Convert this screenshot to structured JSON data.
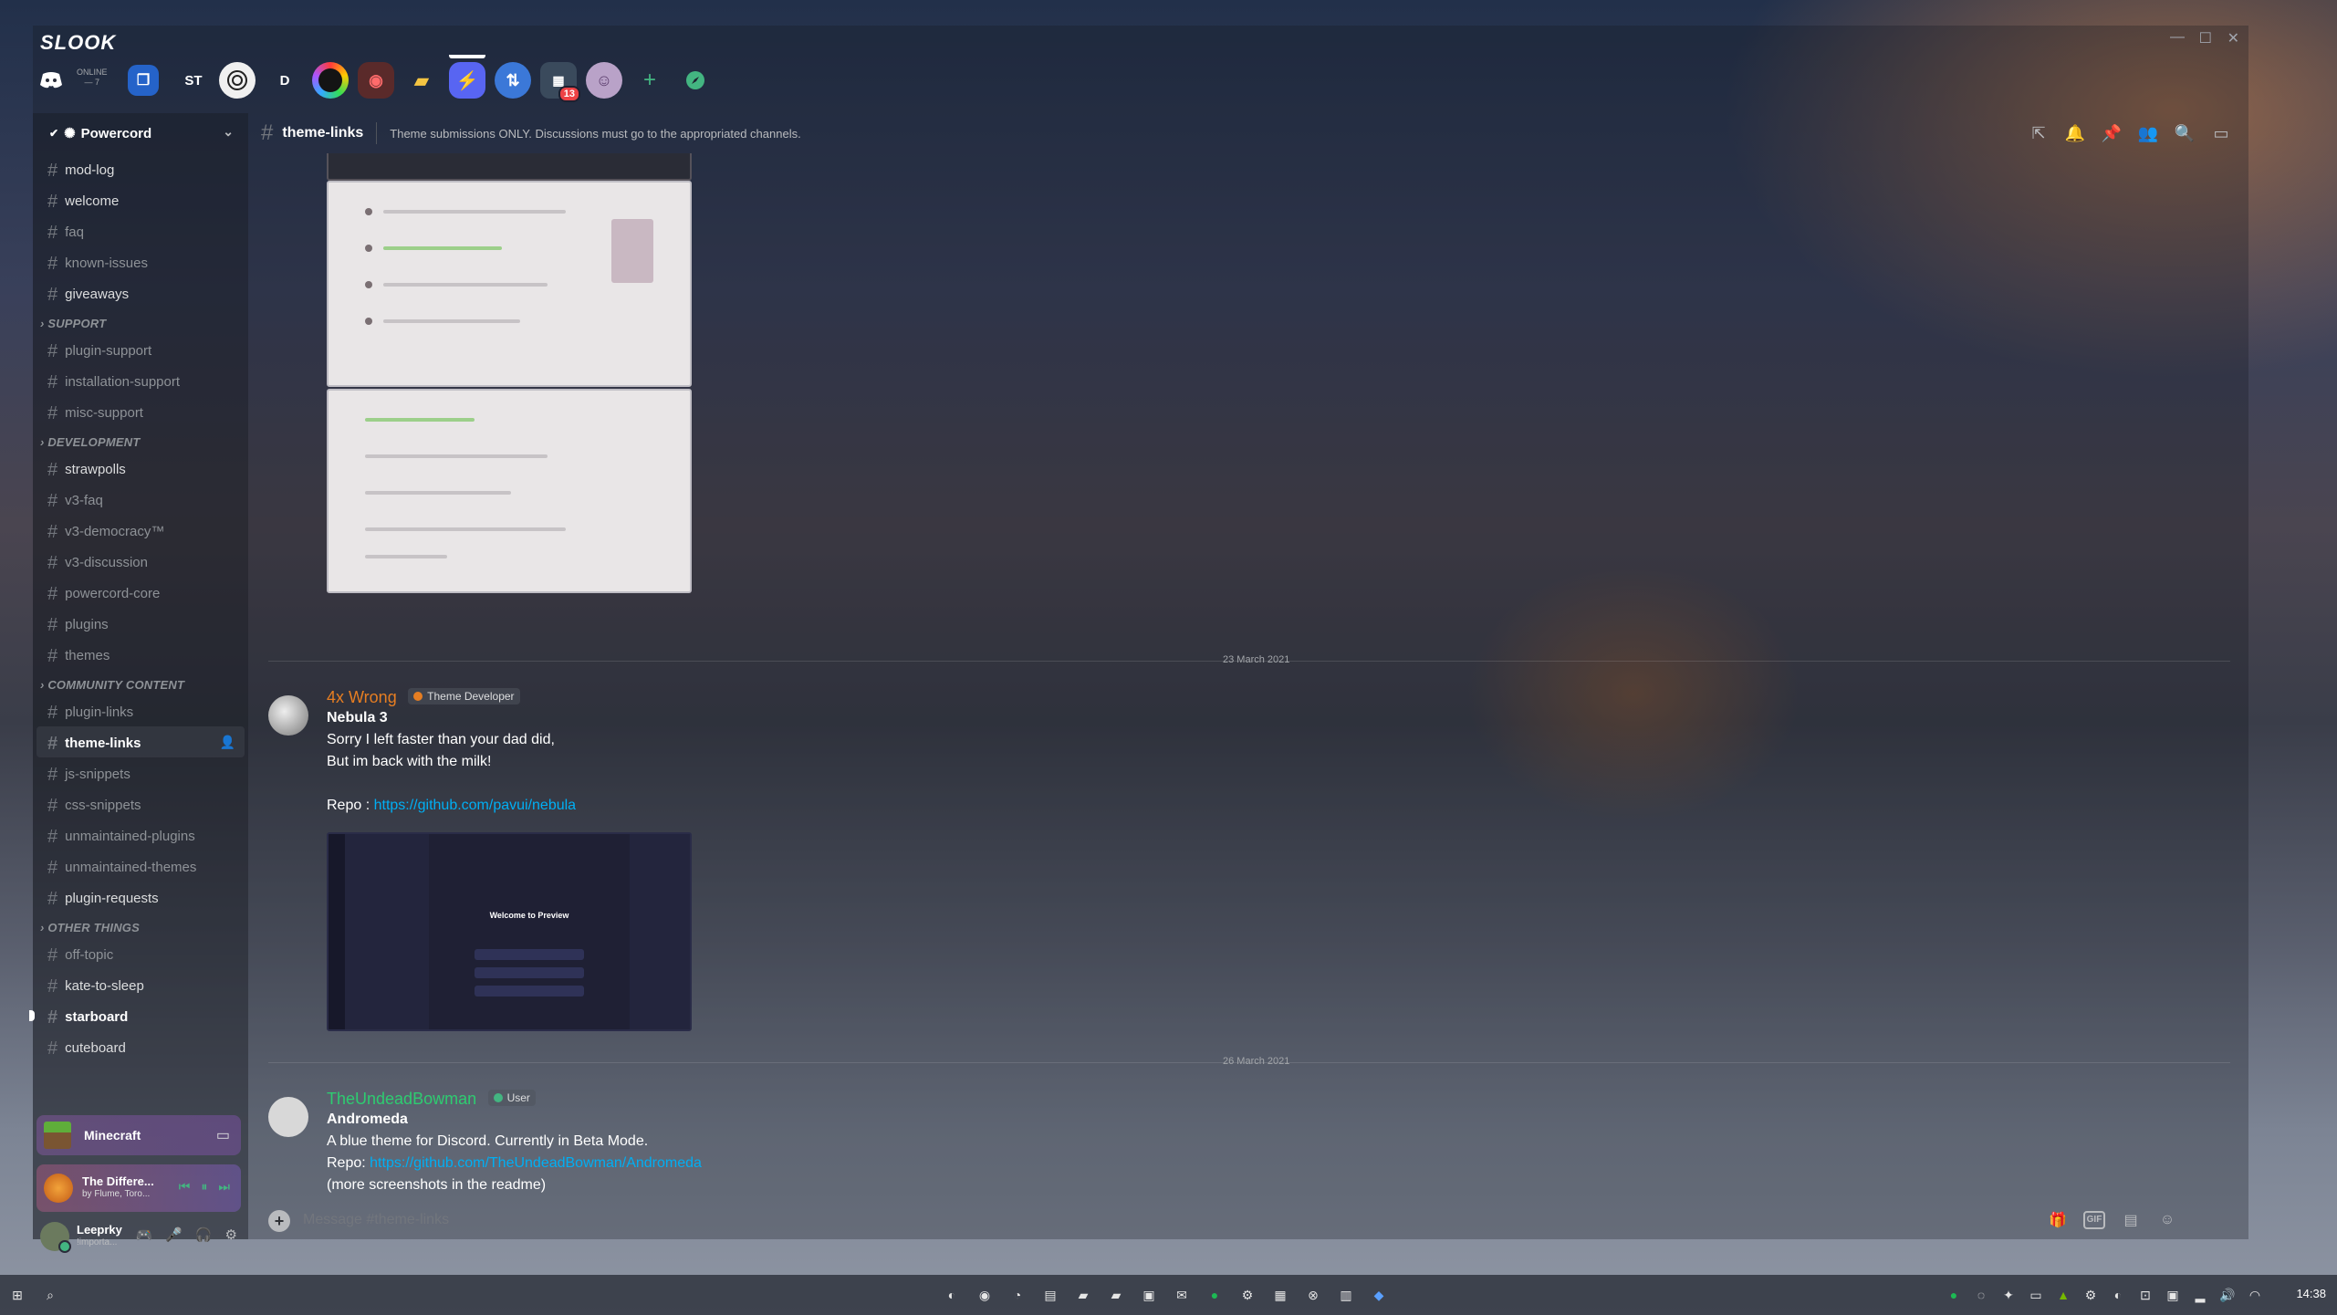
{
  "app": {
    "brand": "SLOOK",
    "window_controls": {
      "minimize": "—",
      "maximize": "☐",
      "close": "✕"
    }
  },
  "serverbar": {
    "online_label": "ONLINE",
    "online_count": "— 7",
    "items": [
      "discord-home",
      "folder-blue",
      "ST",
      "server-circle",
      "D",
      "server-rainbow",
      "server-red",
      "server-yellow-folder",
      "powercord",
      "server-arrows",
      "server-multi",
      "server-avatar"
    ],
    "st_label": "ST",
    "d_label": "D",
    "mentions_badge": "13",
    "add_server": "+",
    "explore": "⌖"
  },
  "guild": {
    "name": "Powercord",
    "chevron": "⌄"
  },
  "channels": {
    "top": [
      "mod-log",
      "welcome",
      "faq",
      "known-issues",
      "giveaways"
    ],
    "support": {
      "label": "SUPPORT",
      "items": [
        "plugin-support",
        "installation-support",
        "misc-support"
      ]
    },
    "development": {
      "label": "DEVELOPMENT",
      "items": [
        "strawpolls",
        "v3-faq",
        "v3-democracy™",
        "v3-discussion",
        "powercord-core",
        "plugins",
        "themes"
      ]
    },
    "community": {
      "label": "COMMUNITY CONTENT",
      "items": [
        "plugin-links",
        "theme-links",
        "js-snippets",
        "css-snippets",
        "unmaintained-plugins",
        "unmaintained-themes",
        "plugin-requests"
      ]
    },
    "other": {
      "label": "OTHER THINGS",
      "items": [
        "off-topic",
        "kate-to-sleep",
        "starboard",
        "cuteboard"
      ]
    }
  },
  "activity": {
    "game": "Minecraft",
    "song_title": "The Differe...",
    "song_artist": "by Flume, Toro...",
    "controls": {
      "prev": "⏮",
      "pause": "⏸",
      "next": "⏭"
    }
  },
  "user": {
    "name": "Leeprky",
    "status": "!importa..."
  },
  "header": {
    "channel": "theme-links",
    "topic": "Theme submissions ONLY. Discussions must go to the appropriated channels."
  },
  "messages": {
    "date1": "23 March 2021",
    "date2": "26 March 2021",
    "m1": {
      "author": "4x Wrong",
      "role": "Theme Developer",
      "title": "Nebula 3",
      "line1": "Sorry I left faster than your dad did,",
      "line2": "But im back with the milk!",
      "repo_label": "Repo :",
      "repo_url": "https://github.com/pavui/nebula",
      "preview_title": "Welcome to Preview"
    },
    "m2": {
      "author": "TheUndeadBowman",
      "role": "User",
      "title": "Andromeda",
      "line1": "A blue theme for Discord. Currently in Beta Mode.",
      "repo_label": "Repo:",
      "repo_url": "https://github.com/TheUndeadBowman/Andromeda",
      "line3": "(more screenshots in the readme)"
    }
  },
  "composer": {
    "placeholder": "Message #theme-links"
  },
  "taskbar": {
    "time": "14:38"
  },
  "colors": {
    "author1": "#e67e22",
    "author2": "#2ecc71",
    "role1_dot": "#e67e22",
    "role2_dot": "#43b581",
    "link": "#00aff4"
  }
}
